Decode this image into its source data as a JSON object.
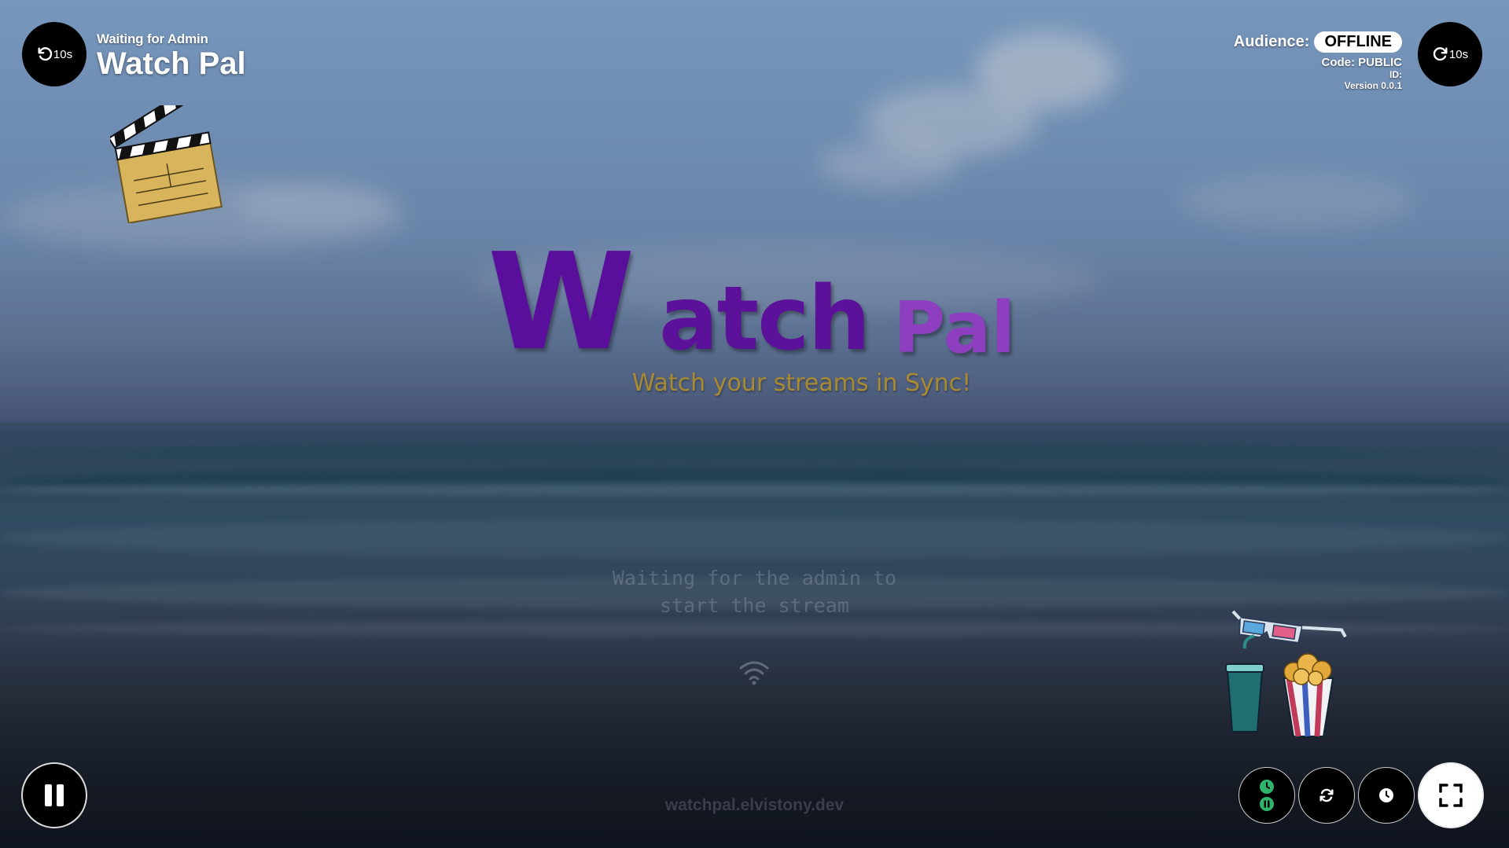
{
  "app": {
    "status": "Waiting for Admin",
    "title": "Watch Pal"
  },
  "seek": {
    "back_label": "10s",
    "forward_label": "10s"
  },
  "info": {
    "audience_label": "Audience:",
    "audience_status": "OFFLINE",
    "code_line": "Code: PUBLIC",
    "id_line": "ID:",
    "version_line": "Version 0.0.1"
  },
  "logo": {
    "w": "W",
    "atch": "atch",
    "pal": "Pal",
    "tagline": "Watch your streams in Sync!"
  },
  "waiting": {
    "line1": "Waiting for the admin to",
    "line2": "start the stream"
  },
  "footer": {
    "url": "watchpal.elvistony.dev"
  },
  "colors": {
    "logo_primary": "#5a0f9c",
    "logo_secondary": "#8d3fc0",
    "tagline": "#a88a30",
    "badge_bg": "#ffffff",
    "sync_icon": "#2fb36b"
  },
  "icons": {
    "back": "rotate-ccw-icon",
    "forward": "rotate-cw-icon",
    "pause": "pause-icon",
    "sync_status": "clock-pause-status-icon",
    "sync": "refresh-icon",
    "clock": "clock-icon",
    "fullscreen": "fullscreen-icon",
    "wifi": "wifi-icon",
    "clapperboard": "clapperboard-icon",
    "snacks": "popcorn-drink-3d-glasses-icon"
  }
}
